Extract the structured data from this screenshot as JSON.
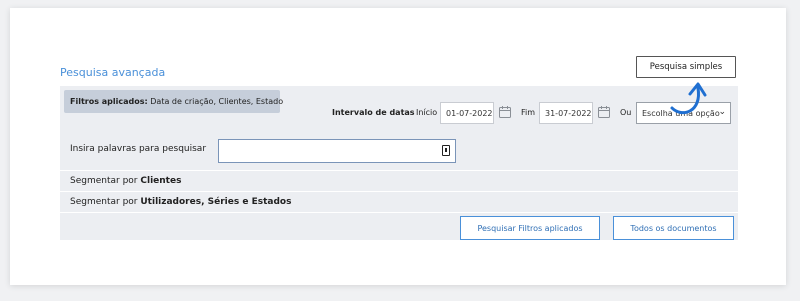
{
  "header": {
    "title": "Pesquisa avançada",
    "simple_search_label": "Pesquisa simples"
  },
  "filters": {
    "prefix": "Filtros aplicados:",
    "values": "Data de criação, Clientes, Estado"
  },
  "date_range": {
    "label": "Intervalo de datas",
    "start_label": "Início",
    "start_value": "01-07-2022",
    "end_label": "Fim",
    "end_value": "31-07-2022",
    "or_label": "Ou",
    "select_value": "Escolha uma opção"
  },
  "search": {
    "label": "Insira palavras para pesquisar",
    "value": ""
  },
  "segments": [
    {
      "prefix": "Segmentar por",
      "target": "Clientes"
    },
    {
      "prefix": "Segmentar por",
      "target": "Utilizadores, Séries e Estados"
    }
  ],
  "actions": {
    "search_applied_label": "Pesquisar Filtros aplicados",
    "all_documents_label": "Todos os documentos"
  },
  "colors": {
    "accent": "#4a90d9",
    "arrow": "#1f6fd1",
    "panel": "#eceef2",
    "badge": "#c6ceda"
  },
  "icons": {
    "calendar": "calendar-icon",
    "chevron": "chevron-down-icon",
    "field": "field-icon",
    "arrow": "curved-arrow-icon"
  }
}
